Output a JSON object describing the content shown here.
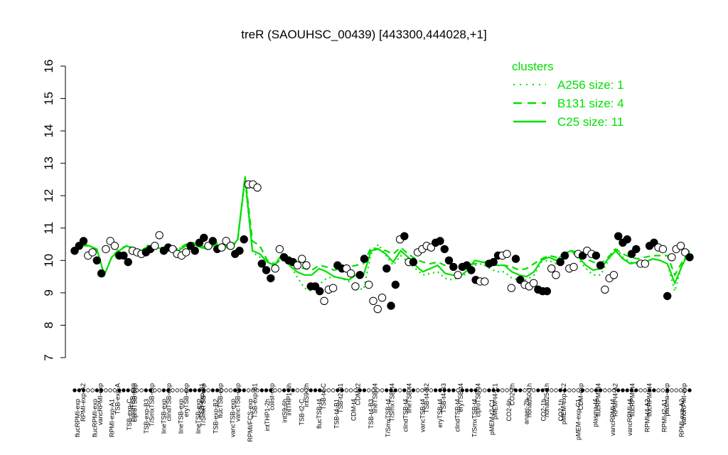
{
  "chart_data": {
    "type": "line",
    "title": "treR (SAOUHSC_00439) [443300,444028,+1]",
    "xlabel": "",
    "ylabel": "",
    "ylim": [
      7,
      16
    ],
    "yticks": [
      7,
      8,
      9,
      10,
      11,
      12,
      13,
      14,
      15,
      16
    ],
    "grid": false,
    "legend_position": "top-right",
    "legend": {
      "title": "clusters",
      "color": "#00e000",
      "entries": [
        {
          "label": "A256 size: 1",
          "style": "dotted"
        },
        {
          "label": "B131 size: 4",
          "style": "dashed"
        },
        {
          "label": "C25 size: 11",
          "style": "solid"
        }
      ]
    },
    "x_labels_top": [
      "RPMI-exp-A2",
      "vancRPMI-exp",
      "TSB-exp-A",
      "ciproTSB-exp",
      "T/SmxTSB-exp",
      "clindTSB-exp",
      "eryTSB-exp",
      "T/SmxTSB-exp",
      "flucTSB-exp",
      "vancTSB-exp",
      "TSB-exp-B1",
      "colist-exp",
      "intTHP1-6h",
      "intS9-2h",
      "TSB-t4-C",
      "TSB-t2-B1",
      "CDM-t2",
      "lineTSB-t4",
      "T/SmxTSB-t4",
      "lineTSB-t4",
      "TSB-t4-B2",
      "TSB-t4-B3",
      "eryTSB-t4",
      "ciproTSB-t4",
      "pMEM-t4-C1",
      "CO2-2h",
      "nonad50-1h",
      "nonad25-1h",
      "pMEM-exp-C2",
      "CDM-exp",
      "flucRPMI-t4",
      "RPMI-t4-A2",
      "flucRPMI-t4",
      "flucRPMI-t4",
      "plasma-exp",
      "vancRPMI-exp"
    ],
    "x_labels_bottom": [
      "flucRPMI-exp",
      "flucRPMI-exp",
      "RPMI-exp-A1",
      "TSB-exp-C",
      "TSB-exp-B3",
      "lineTSB-exp",
      "lineTSB-exp",
      "lineTSB-exp",
      "TSB-exp-B2",
      "vancTSB-exp",
      "RPMI/FCS-exp",
      "intTHP1-2h",
      "intS9-6h",
      "TSB-t2-C",
      "flucTSB-t4",
      "TSB-t4-B1",
      "CDM-t4",
      "TSB-t4-B3",
      "T/SmxTSB-t4",
      "clindTSB-t4",
      "vancTSB-t4",
      "eryTSB-t4",
      "clindTSB-t4",
      "T/SmxTSB-t4",
      "pMEM-t2-C1",
      "CO2-6h",
      "anaer-2h",
      "CO2-1h",
      "CO2-1h",
      "pMEM-exp-C1",
      "plasma-t4",
      "vancRPMI-t4",
      "vancRPMI-t4",
      "RPMI-t4-A2",
      "RPMI-t2-A1",
      "RPMI-exp-A2"
    ],
    "x_extra_labels": [
      "ciproTSB-exp",
      "TSB-exp-B1"
    ],
    "series": [
      {
        "style": "solid",
        "values": [
          10.35,
          10.45,
          10.45,
          10.35,
          9.55,
          10.1,
          10.3,
          10.45,
          10.35,
          10.3,
          10.45,
          10.4,
          10.35,
          10.3,
          10.3,
          10.45,
          10.5,
          10.4,
          10.35,
          10.5,
          10.45,
          10.35,
          10.65,
          12.55,
          10.3,
          10.2,
          9.95,
          9.85,
          10.2,
          9.85,
          9.65,
          9.55,
          9.55,
          9.75,
          9.65,
          9.5,
          9.45,
          9.4,
          9.55,
          9.55,
          10.3,
          10.35,
          10.2,
          9.95,
          10.3,
          10.1,
          9.85,
          9.65,
          9.75,
          9.85,
          9.6,
          9.55,
          9.5,
          9.7,
          10.0,
          9.95,
          9.9,
          9.85,
          9.85,
          9.65,
          9.55,
          9.5,
          9.65,
          10.0,
          10.1,
          10.0,
          10.2,
          10.3,
          10.1,
          9.85,
          9.7,
          9.75,
          10.05,
          10.3,
          10.05,
          9.9,
          9.95,
          9.95,
          10.05,
          10.0,
          9.9,
          9.3,
          9.85,
          10.3
        ]
      },
      {
        "style": "dashed",
        "values": [
          10.3,
          10.5,
          10.45,
          10.3,
          9.55,
          10.1,
          10.35,
          10.45,
          10.3,
          10.3,
          10.45,
          10.4,
          10.35,
          10.4,
          10.35,
          10.5,
          10.55,
          10.45,
          10.4,
          10.55,
          10.5,
          10.4,
          10.6,
          12.6,
          10.6,
          10.45,
          10.0,
          9.9,
          10.0,
          9.95,
          9.8,
          9.75,
          9.7,
          9.85,
          9.8,
          9.7,
          9.75,
          9.8,
          9.85,
          9.9,
          10.4,
          10.35,
          10.3,
          10.2,
          10.4,
          10.2,
          10.05,
          9.95,
          9.9,
          9.95,
          9.85,
          9.8,
          9.8,
          9.85,
          9.9,
          9.95,
          9.95,
          9.85,
          9.85,
          9.8,
          9.7,
          9.75,
          9.9,
          10.05,
          10.15,
          10.1,
          10.2,
          10.3,
          10.25,
          10.05,
          9.95,
          9.9,
          10.1,
          10.35,
          10.2,
          10.1,
          10.05,
          10.1,
          10.15,
          10.15,
          10.15,
          9.55,
          9.95,
          10.3
        ]
      },
      {
        "style": "dotted",
        "values": [
          10.3,
          10.55,
          10.45,
          10.3,
          9.55,
          10.1,
          10.3,
          10.45,
          10.4,
          10.3,
          10.5,
          10.4,
          10.4,
          10.3,
          10.35,
          10.5,
          10.5,
          10.45,
          10.4,
          10.55,
          10.5,
          10.4,
          10.65,
          12.45,
          10.25,
          10.1,
          9.95,
          9.8,
          10.1,
          9.9,
          9.5,
          9.15,
          9.05,
          9.25,
          9.45,
          9.5,
          9.45,
          9.35,
          9.15,
          9.1,
          10.2,
          10.5,
          10.15,
          9.85,
          10.15,
          9.95,
          9.75,
          9.55,
          9.6,
          9.65,
          9.45,
          9.4,
          9.5,
          9.6,
          9.85,
          9.9,
          9.75,
          9.65,
          9.65,
          9.45,
          9.4,
          9.4,
          9.55,
          9.95,
          10.0,
          9.9,
          10.15,
          10.3,
          10.05,
          9.75,
          9.55,
          9.55,
          10.0,
          10.4,
          10.1,
          9.95,
          9.9,
          9.95,
          10.05,
          10.0,
          9.9,
          9.05,
          9.9,
          10.3
        ]
      }
    ],
    "points": [
      {
        "v": 10.3,
        "f": 1
      },
      {
        "v": 10.45,
        "f": 1
      },
      {
        "v": 10.6,
        "f": 1
      },
      {
        "v": 10.15,
        "f": 0
      },
      {
        "v": 10.25,
        "f": 0
      },
      {
        "v": 10.0,
        "f": 1
      },
      {
        "v": 9.6,
        "f": 1
      },
      {
        "v": 10.35,
        "f": 0
      },
      {
        "v": 10.6,
        "f": 0
      },
      {
        "v": 10.45,
        "f": 0
      },
      {
        "v": 10.15,
        "f": 1
      },
      {
        "v": 10.15,
        "f": 1
      },
      {
        "v": 9.95,
        "f": 1
      },
      {
        "v": 10.3,
        "f": 0
      },
      {
        "v": 10.25,
        "f": 0
      },
      {
        "v": 10.2,
        "f": 0
      },
      {
        "v": 10.25,
        "f": 1
      },
      {
        "v": 10.35,
        "f": 1
      },
      {
        "v": 10.45,
        "f": 0
      },
      {
        "v": 10.78,
        "f": 0
      },
      {
        "v": 10.3,
        "f": 1
      },
      {
        "v": 10.4,
        "f": 1
      },
      {
        "v": 10.35,
        "f": 0
      },
      {
        "v": 10.2,
        "f": 0
      },
      {
        "v": 10.15,
        "f": 0
      },
      {
        "v": 10.25,
        "f": 0
      },
      {
        "v": 10.45,
        "f": 1
      },
      {
        "v": 10.3,
        "f": 1
      },
      {
        "v": 10.55,
        "f": 1
      },
      {
        "v": 10.7,
        "f": 1
      },
      {
        "v": 10.45,
        "f": 0
      },
      {
        "v": 10.6,
        "f": 1
      },
      {
        "v": 10.35,
        "f": 1
      },
      {
        "v": 10.4,
        "f": 0
      },
      {
        "v": 10.6,
        "f": 0
      },
      {
        "v": 10.45,
        "f": 0
      },
      {
        "v": 10.2,
        "f": 1
      },
      {
        "v": 10.3,
        "f": 1
      },
      {
        "v": 10.65,
        "f": 1
      },
      {
        "v": 12.35,
        "f": 0
      },
      {
        "v": 12.35,
        "f": 0
      },
      {
        "v": 12.25,
        "f": 0
      },
      {
        "v": 9.9,
        "f": 1
      },
      {
        "v": 9.7,
        "f": 1
      },
      {
        "v": 9.45,
        "f": 1
      },
      {
        "v": 9.75,
        "f": 0
      },
      {
        "v": 10.35,
        "f": 0
      },
      {
        "v": 10.1,
        "f": 1
      },
      {
        "v": 10.0,
        "f": 1
      },
      {
        "v": 9.95,
        "f": 1
      },
      {
        "v": 9.85,
        "f": 0
      },
      {
        "v": 10.05,
        "f": 0
      },
      {
        "v": 9.85,
        "f": 0
      },
      {
        "v": 9.2,
        "f": 1
      },
      {
        "v": 9.2,
        "f": 1
      },
      {
        "v": 9.05,
        "f": 1
      },
      {
        "v": 8.75,
        "f": 0
      },
      {
        "v": 9.1,
        "f": 0
      },
      {
        "v": 9.15,
        "f": 0
      },
      {
        "v": 9.85,
        "f": 1
      },
      {
        "v": 9.75,
        "f": 1
      },
      {
        "v": 9.75,
        "f": 0
      },
      {
        "v": 9.6,
        "f": 0
      },
      {
        "v": 9.2,
        "f": 0
      },
      {
        "v": 9.55,
        "f": 1
      },
      {
        "v": 10.05,
        "f": 1
      },
      {
        "v": 9.25,
        "f": 0
      },
      {
        "v": 8.75,
        "f": 0
      },
      {
        "v": 8.5,
        "f": 0
      },
      {
        "v": 8.85,
        "f": 0
      },
      {
        "v": 9.75,
        "f": 1
      },
      {
        "v": 8.6,
        "f": 1
      },
      {
        "v": 9.25,
        "f": 1
      },
      {
        "v": 10.65,
        "f": 0
      },
      {
        "v": 10.75,
        "f": 1
      },
      {
        "v": 9.95,
        "f": 0
      },
      {
        "v": 9.95,
        "f": 1
      },
      {
        "v": 10.25,
        "f": 0
      },
      {
        "v": 10.35,
        "f": 0
      },
      {
        "v": 10.45,
        "f": 0
      },
      {
        "v": 10.4,
        "f": 0
      },
      {
        "v": 10.55,
        "f": 1
      },
      {
        "v": 10.6,
        "f": 1
      },
      {
        "v": 10.35,
        "f": 1
      },
      {
        "v": 10.0,
        "f": 1
      },
      {
        "v": 9.8,
        "f": 1
      },
      {
        "v": 9.55,
        "f": 0
      },
      {
        "v": 9.8,
        "f": 1
      },
      {
        "v": 9.85,
        "f": 1
      },
      {
        "v": 9.7,
        "f": 1
      },
      {
        "v": 9.4,
        "f": 1
      },
      {
        "v": 9.35,
        "f": 0
      },
      {
        "v": 9.35,
        "f": 0
      },
      {
        "v": 9.9,
        "f": 1
      },
      {
        "v": 9.95,
        "f": 1
      },
      {
        "v": 10.15,
        "f": 1
      },
      {
        "v": 10.15,
        "f": 0
      },
      {
        "v": 10.2,
        "f": 0
      },
      {
        "v": 9.15,
        "f": 0
      },
      {
        "v": 10.05,
        "f": 1
      },
      {
        "v": 9.4,
        "f": 1
      },
      {
        "v": 9.25,
        "f": 0
      },
      {
        "v": 9.2,
        "f": 0
      },
      {
        "v": 9.3,
        "f": 0
      },
      {
        "v": 9.1,
        "f": 1
      },
      {
        "v": 9.05,
        "f": 1
      },
      {
        "v": 9.05,
        "f": 1
      },
      {
        "v": 9.75,
        "f": 0
      },
      {
        "v": 9.55,
        "f": 0
      },
      {
        "v": 9.95,
        "f": 1
      },
      {
        "v": 10.15,
        "f": 1
      },
      {
        "v": 9.75,
        "f": 0
      },
      {
        "v": 9.8,
        "f": 0
      },
      {
        "v": 10.2,
        "f": 0
      },
      {
        "v": 10.15,
        "f": 1
      },
      {
        "v": 10.3,
        "f": 0
      },
      {
        "v": 10.2,
        "f": 0
      },
      {
        "v": 10.15,
        "f": 1
      },
      {
        "v": 9.85,
        "f": 1
      },
      {
        "v": 9.1,
        "f": 0
      },
      {
        "v": 9.45,
        "f": 0
      },
      {
        "v": 9.55,
        "f": 0
      },
      {
        "v": 10.75,
        "f": 1
      },
      {
        "v": 10.55,
        "f": 1
      },
      {
        "v": 10.65,
        "f": 1
      },
      {
        "v": 10.2,
        "f": 1
      },
      {
        "v": 10.35,
        "f": 1
      },
      {
        "v": 9.9,
        "f": 0
      },
      {
        "v": 9.9,
        "f": 0
      },
      {
        "v": 10.45,
        "f": 1
      },
      {
        "v": 10.55,
        "f": 1
      },
      {
        "v": 10.4,
        "f": 0
      },
      {
        "v": 10.35,
        "f": 0
      },
      {
        "v": 8.9,
        "f": 1
      },
      {
        "v": 10.1,
        "f": 0
      },
      {
        "v": 10.35,
        "f": 0
      },
      {
        "v": 10.45,
        "f": 0
      },
      {
        "v": 10.25,
        "f": 0
      },
      {
        "v": 10.1,
        "f": 1
      }
    ]
  }
}
